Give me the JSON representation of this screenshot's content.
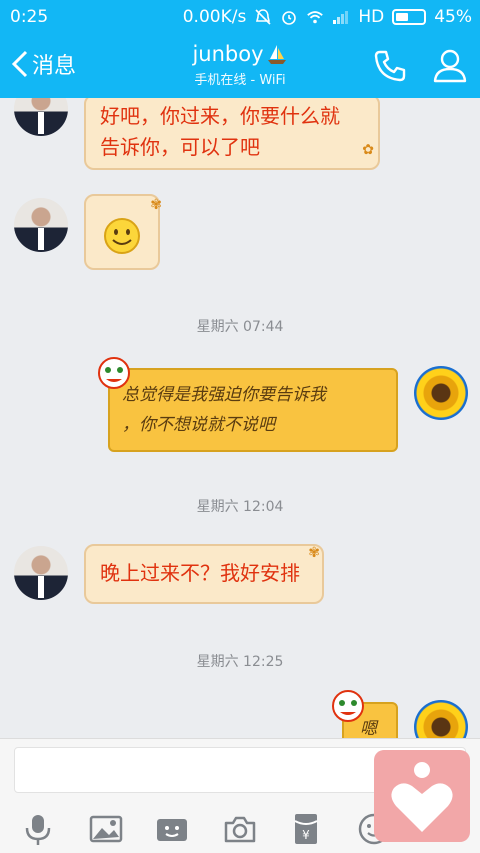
{
  "status_bar": {
    "time": "0:25",
    "network_speed": "0.00K/s",
    "network_type": "HD",
    "battery": "45%"
  },
  "nav": {
    "back_label": "消息",
    "title": "junboy",
    "subtitle": "手机在线 - WiFi"
  },
  "messages": [
    {
      "side": "left",
      "text_line1": "好吧，你过来，你要什么就",
      "text_line2": "告诉你，可以了吧"
    },
    {
      "side": "left",
      "emoji": "☺"
    },
    {
      "timestamp": "星期六 07:44"
    },
    {
      "side": "right",
      "text_line1": "总觉得是我强迫你要告诉我",
      "text_line2": "，你不想说就不说吧"
    },
    {
      "timestamp": "星期六 12:04"
    },
    {
      "side": "left",
      "text_line1": "晚上过来不？我好安排"
    },
    {
      "timestamp": "星期六 12:25"
    },
    {
      "side": "right",
      "text_line1": "嗯"
    }
  ],
  "input": {
    "value": "",
    "placeholder": ""
  },
  "toolbar": [
    "mic-icon",
    "image-icon",
    "video-icon",
    "camera-icon",
    "red-packet-icon",
    "emoji-icon"
  ],
  "colors": {
    "header": "#12b7f5",
    "left_bubble": "#fbe9c9",
    "right_bubble": "#f9c340",
    "float_button": "#f2a7a8"
  }
}
